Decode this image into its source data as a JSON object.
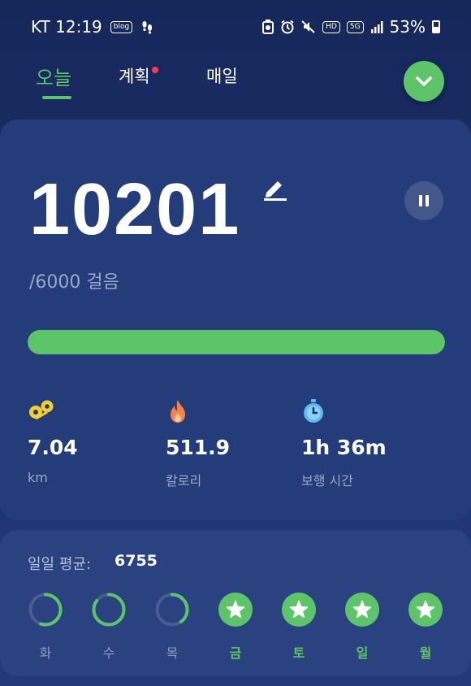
{
  "status_bar": {
    "carrier_time": "KT 12:19",
    "notif_icons": [
      "blog-icon",
      "footsteps-icon"
    ],
    "blog_label": "blog",
    "hd_label": "HD",
    "network_label": "5G",
    "battery": "53%"
  },
  "tabs": [
    {
      "label": "오늘",
      "active": true
    },
    {
      "label": "계획",
      "active": false,
      "badge": true
    },
    {
      "label": "매일",
      "active": false
    }
  ],
  "steps": {
    "value": "10201",
    "goal_text": "/6000 걸음",
    "progress_percent": 100
  },
  "stats": [
    {
      "icon": "distance-icon",
      "value": "7.04",
      "label": "km",
      "color": "#f2d12e"
    },
    {
      "icon": "flame-icon",
      "value": "511.9",
      "label": "칼로리",
      "color": "#f2834a"
    },
    {
      "icon": "stopwatch-icon",
      "value": "1h 36m",
      "label": "보행 시간",
      "color": "#5fb8f0"
    }
  ],
  "weekly": {
    "avg_label": "일일 평균:",
    "avg_value": "6755",
    "days": [
      {
        "label": "화",
        "achieved": false,
        "fraction": 0.55
      },
      {
        "label": "수",
        "achieved": false,
        "fraction": 0.85
      },
      {
        "label": "목",
        "achieved": false,
        "fraction": 0.4
      },
      {
        "label": "금",
        "achieved": true,
        "fraction": 1
      },
      {
        "label": "토",
        "achieved": true,
        "fraction": 1
      },
      {
        "label": "일",
        "achieved": true,
        "fraction": 1
      },
      {
        "label": "월",
        "achieved": true,
        "fraction": 1
      }
    ]
  },
  "colors": {
    "accent_green": "#5ec46a",
    "badge_red": "#ff3b4a",
    "background": "#1d3370"
  }
}
